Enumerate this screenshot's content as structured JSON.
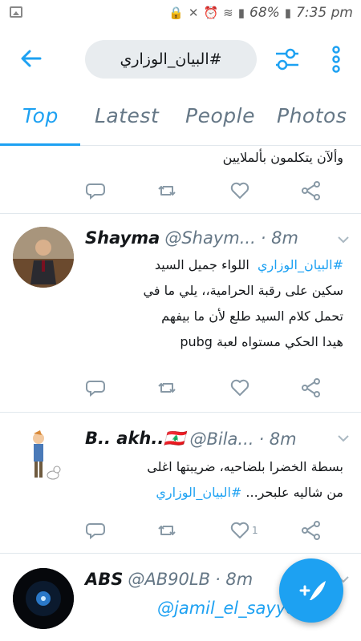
{
  "status_bar": {
    "battery": "68%",
    "time": "7:35 pm"
  },
  "header": {
    "search_query": "#البيان_الوزاري"
  },
  "tabs": [
    {
      "label": "Top",
      "active": true
    },
    {
      "label": "Latest",
      "active": false
    },
    {
      "label": "People",
      "active": false
    },
    {
      "label": "Photos",
      "active": false
    }
  ],
  "tweets": [
    {
      "text_lines": [
        "وألآن يتكلمون بألملايين"
      ]
    },
    {
      "name": "Shayma",
      "handle": "@Shaym...",
      "time": "· 8m",
      "hashtag": "#البيان_الوزاري",
      "line1_rest": "اللواء جميل السيد",
      "line2": "سكين على رقبة الحرامية،، يلي ما في",
      "line3": "تحمل كلام السيد طلع لأن ما بيفهم",
      "line4": "هيدا الحكي مستواه لعبة pubg"
    },
    {
      "name": "B.. akh..🇱🇧",
      "handle": "@Bila...",
      "time": "· 8m",
      "line1": "بسطة الخضرا بلضاحيه، ضريبتها اغلى",
      "line2_rest": "من شاليه علبحر...",
      "hashtag": "#البيان_الوزاري",
      "like_count": "1"
    },
    {
      "name": "ABS",
      "handle": "@AB90LB",
      "time": "· 8m",
      "mention": "@jamil_el_sayyed"
    }
  ],
  "colors": {
    "accent": "#1da1f2",
    "text": "#14171a",
    "muted": "#657786"
  },
  "icons": [
    "back-arrow-icon",
    "filter-sliders-icon",
    "more-vertical-icon",
    "reply-icon",
    "retweet-icon",
    "like-icon",
    "share-icon",
    "compose-icon"
  ]
}
